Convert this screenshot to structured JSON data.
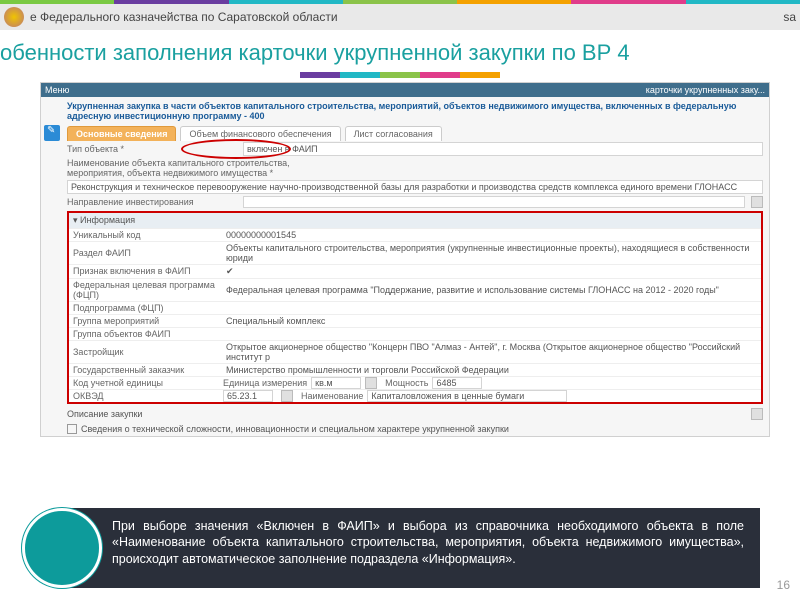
{
  "stripe_colors": [
    "#7ac943",
    "#6a3da0",
    "#21b8c5",
    "#8bc34a",
    "#f4a100",
    "#e03c8a",
    "#21b8c5"
  ],
  "header": {
    "org": "е Федерального казначейства по Саратовской области",
    "right": "sa"
  },
  "title": "обенности заполнения карточки укрупненной закупки по ВР 4",
  "accent_colors": [
    "#6a3da0",
    "#21b8c5",
    "#8bc34a",
    "#e03c8a",
    "#f4a100"
  ],
  "screenshot": {
    "menu": "Меню",
    "breadcrumb": "карточки укрупненных заку...",
    "sec_title": "Укрупненная закупка в части объектов капитального строительства, мероприятий, объектов недвижимого имущества, включенных в федеральную адресную инвестиционную программу - 400",
    "tabs": [
      "Основные сведения",
      "Объем финансового обеспечения",
      "Лист согласования"
    ],
    "rows": {
      "tip": {
        "label": "Тип объекта *",
        "value": "включен в ФАИП"
      },
      "naim": {
        "label": "Наименование объекта капитального строительства, мероприятия, объекта недвижимого имущества *",
        "value": "Реконструкция и техническое перевооружение научно-производственной базы для разработки и производства средств комплекса единого времени ГЛОНАСС"
      },
      "napr": {
        "label": "Направление инвестирования",
        "value": ""
      }
    },
    "info": {
      "header": "▾ Информация",
      "rows": [
        {
          "l": "Уникальный код",
          "v": "00000000001545"
        },
        {
          "l": "Раздел ФАИП",
          "v": "Объекты капитального строительства, мероприятия (укрупненные инвестиционные проекты), находящиеся в собственности юриди"
        },
        {
          "l": "Признак включения в ФАИП",
          "v": "✔"
        },
        {
          "l": "Федеральная целевая программа (ФЦП)",
          "v": "Федеральная целевая программа \"Поддержание, развитие и использование системы ГЛОНАСС на 2012 - 2020 годы\""
        },
        {
          "l": "Подпрограмма (ФЦП)",
          "v": ""
        },
        {
          "l": "Группа мероприятий",
          "v": "Специальный комплекс"
        },
        {
          "l": "Группа объектов ФАИП",
          "v": ""
        },
        {
          "l": "Застройщик",
          "v": "Открытое акционерное общество \"Концерн ПВО \"Алмаз - Антей\", г. Москва (Открытое акционерное общество \"Российский институт р"
        },
        {
          "l": "Государственный заказчик",
          "v": "Министерство промышленности и торговли Российской Федерации"
        }
      ],
      "kod": {
        "l": "Код учетной единицы",
        "unit_l": "Единица измерения",
        "unit_v": "кв.м",
        "pow_l": "Мощность",
        "pow_v": "6485"
      },
      "okved": {
        "l": "ОКВЭД",
        "code": "65.23.1",
        "name_l": "Наименование",
        "name_v": "Капиталовложения в ценные бумаги"
      }
    },
    "opis": "Описание закупки",
    "checkbox_row": "Сведения о технической сложности, инновационности и специальном характере укрупненной закупки"
  },
  "callout": "При выборе значения «Включен в ФАИП» и выбора из справочника необходимого объекта в поле «Наименование объекта капитального строительства, мероприятия, объекта недвижимого имущества», происходит автоматическое заполнение подраздела «Информация».",
  "page_number": "16"
}
